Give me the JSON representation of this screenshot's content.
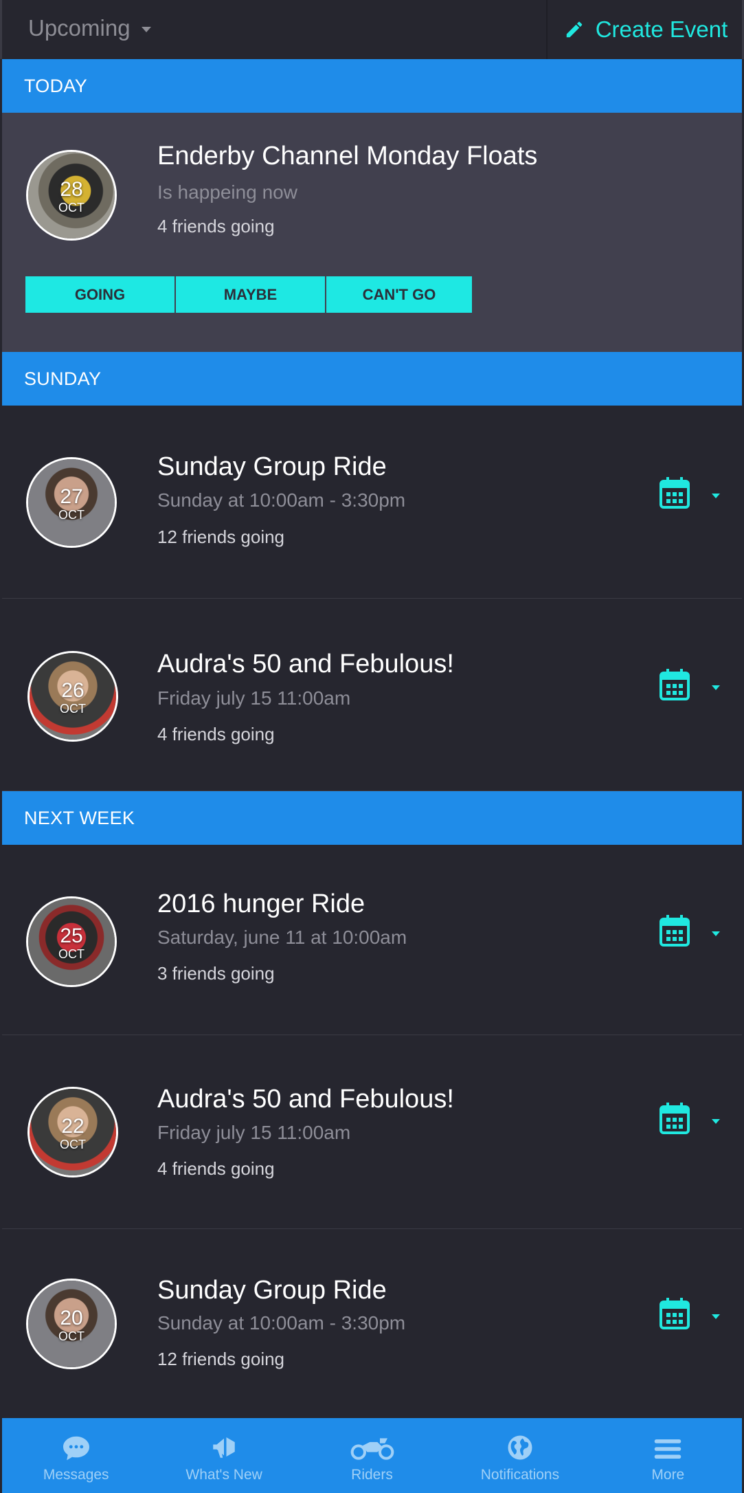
{
  "topbar": {
    "filter_label": "Upcoming",
    "create_label": "Create Event"
  },
  "sections": {
    "today": "TODAY",
    "sunday": "SUNDAY",
    "next_week": "NEXT WEEK"
  },
  "featured": {
    "title": "Enderby Channel Monday Floats",
    "status": "Is happeing now",
    "friends": "4 friends going",
    "day": "28",
    "month": "OCT",
    "rsvp": [
      "GOING",
      "MAYBE",
      "CAN'T GO"
    ]
  },
  "events": [
    {
      "title": "Sunday Group Ride",
      "time": "Sunday at 10:00am - 3:30pm",
      "friends": "12 friends going",
      "day": "27",
      "month": "OCT"
    },
    {
      "title": "Audra's 50 and Febulous!",
      "time": "Friday july 15 11:00am",
      "friends": "4 friends going",
      "day": "26",
      "month": "OCT"
    },
    {
      "title": "2016 hunger Ride",
      "time": "Saturday, june 11 at 10:00am",
      "friends": "3 friends going",
      "day": "25",
      "month": "OCT"
    },
    {
      "title": "Audra's 50 and Febulous!",
      "time": "Friday july 15 11:00am",
      "friends": "4 friends going",
      "day": "22",
      "month": "OCT"
    },
    {
      "title": "Sunday Group Ride",
      "time": "Sunday at 10:00am - 3:30pm",
      "friends": "12 friends going",
      "day": "20",
      "month": "OCT"
    }
  ],
  "tabs": [
    {
      "label": "Messages",
      "icon": "chat-bubble-icon"
    },
    {
      "label": "What's New",
      "icon": "megaphone-icon"
    },
    {
      "label": "Riders",
      "icon": "motorcycle-icon"
    },
    {
      "label": "Notifications",
      "icon": "globe-icon"
    },
    {
      "label": "More",
      "icon": "menu-icon"
    }
  ],
  "colors": {
    "accent": "#1ee8e3",
    "header_blue": "#1f8ce9",
    "background": "#26262f",
    "highlight_card": "#41404e"
  }
}
